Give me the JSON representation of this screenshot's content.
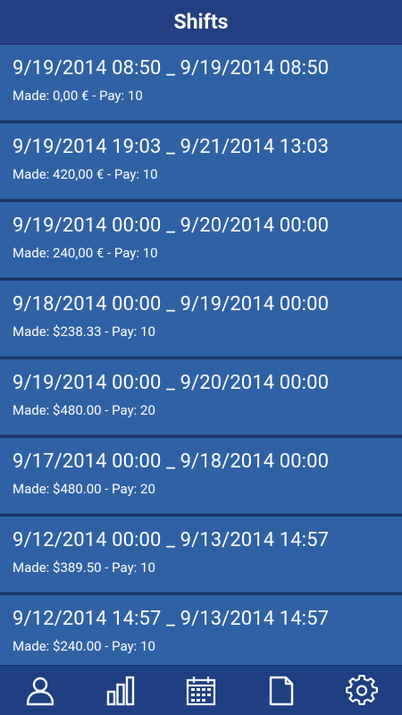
{
  "header": {
    "title": "Shifts"
  },
  "shifts": [
    {
      "range": "9/19/2014 08:50 _ 9/19/2014 08:50",
      "made": "Made: 0,00 € - Pay: 10"
    },
    {
      "range": "9/19/2014 19:03 _ 9/21/2014 13:03",
      "made": "Made: 420,00 € - Pay: 10"
    },
    {
      "range": "9/19/2014 00:00 _ 9/20/2014 00:00",
      "made": "Made: 240,00 € - Pay: 10"
    },
    {
      "range": "9/18/2014 00:00 _ 9/19/2014 00:00",
      "made": "Made: $238.33 - Pay: 10"
    },
    {
      "range": "9/19/2014 00:00 _ 9/20/2014 00:00",
      "made": "Made: $480.00 - Pay: 20"
    },
    {
      "range": "9/17/2014 00:00 _ 9/18/2014 00:00",
      "made": "Made: $480.00 - Pay: 20"
    },
    {
      "range": "9/12/2014 00:00 _ 9/13/2014 14:57",
      "made": "Made: $389.50 - Pay: 10"
    },
    {
      "range": "9/12/2014 14:57 _ 9/13/2014 14:57",
      "made": "Made: $240.00 - Pay: 10"
    }
  ],
  "tabbar": {
    "tabs": [
      {
        "icon": "user-icon"
      },
      {
        "icon": "bar-chart-icon"
      },
      {
        "icon": "calendar-icon"
      },
      {
        "icon": "document-icon"
      },
      {
        "icon": "gear-icon"
      }
    ]
  },
  "colors": {
    "header_bg": "#233f84",
    "item_bg": "#2f62a5",
    "tabbar_bg": "#1e3f81",
    "text": "#ffffff"
  }
}
